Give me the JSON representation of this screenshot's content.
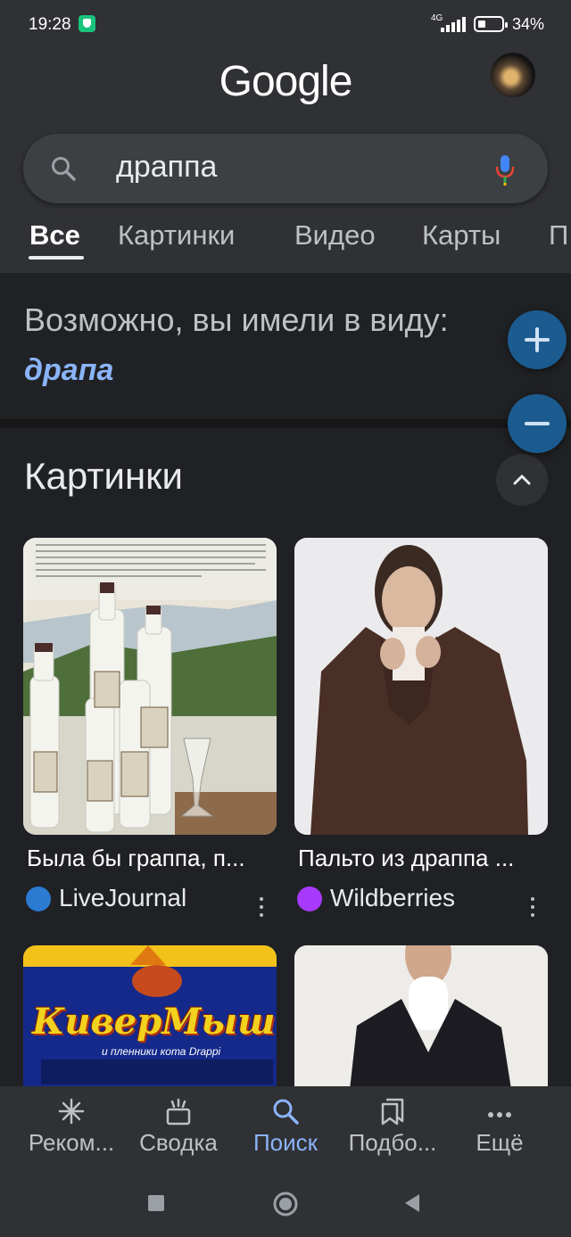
{
  "status_bar": {
    "time": "19:28",
    "network": "4G",
    "battery": "34%"
  },
  "header": {
    "logo": "Google"
  },
  "search": {
    "query": "драппа"
  },
  "tabs": [
    {
      "label": "Все"
    },
    {
      "label": "Картинки"
    },
    {
      "label": "Видео"
    },
    {
      "label": "Карты"
    },
    {
      "label": "П"
    }
  ],
  "suggestion": {
    "title": "Возможно, вы имели в виду:",
    "link": "драпа"
  },
  "images_section": {
    "title": "Картинки",
    "results": [
      {
        "title": "Была бы граппа, п...",
        "source": "LiveJournal",
        "source_color": "#2b7bd2"
      },
      {
        "title": "Пальто из драппа ...",
        "source": "Wildberries",
        "source_color": "#a73afd"
      },
      {
        "image_text": "КиверМышь",
        "image_subtext": "и пленники кота Drappi"
      }
    ]
  },
  "bottom_nav": [
    {
      "label": "Реком...",
      "icon": "asterisk-icon"
    },
    {
      "label": "Сводка",
      "icon": "summary-icon"
    },
    {
      "label": "Поиск",
      "icon": "search-icon",
      "active": true
    },
    {
      "label": "Подбо...",
      "icon": "collections-icon"
    },
    {
      "label": "Ещё",
      "icon": "more-icon"
    }
  ],
  "colors": {
    "link": "#8ab4f8",
    "accent_fab": "#1c5b8f",
    "background": "#202124",
    "surface": "#303134"
  }
}
